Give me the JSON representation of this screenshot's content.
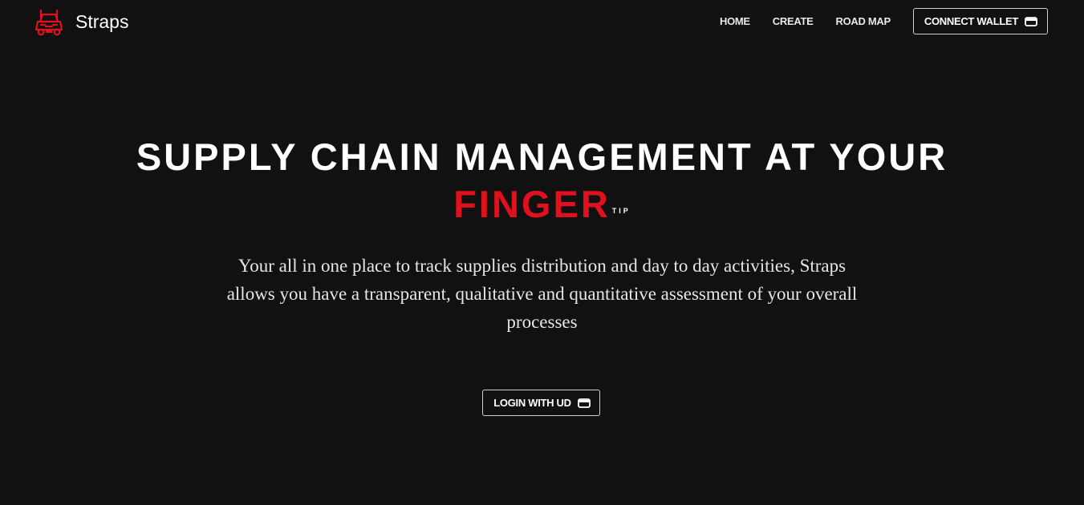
{
  "brand": {
    "name": "Straps",
    "logo_icon": "truck-icon",
    "accent_color": "#e0111c"
  },
  "nav": {
    "items": [
      {
        "label": "HOME"
      },
      {
        "label": "CREATE"
      },
      {
        "label": "ROAD MAP"
      }
    ],
    "connect_button": {
      "label": "CONNECT WALLET",
      "icon": "wallet-icon"
    }
  },
  "hero": {
    "title_line1": "SUPPLY CHAIN MANAGEMENT AT YOUR",
    "title_accent": "FINGER",
    "title_sup": "TIP",
    "description": "Your all in one place to track supplies distribution and day to day activities, Straps allows you have a transparent, qualitative and quantitative assessment of your overall processes",
    "login_button": {
      "label": "LOGIN WITH UD",
      "icon": "wallet-icon"
    }
  },
  "colors": {
    "background": "#111111",
    "text": "#ffffff",
    "accent": "#e0111c"
  }
}
